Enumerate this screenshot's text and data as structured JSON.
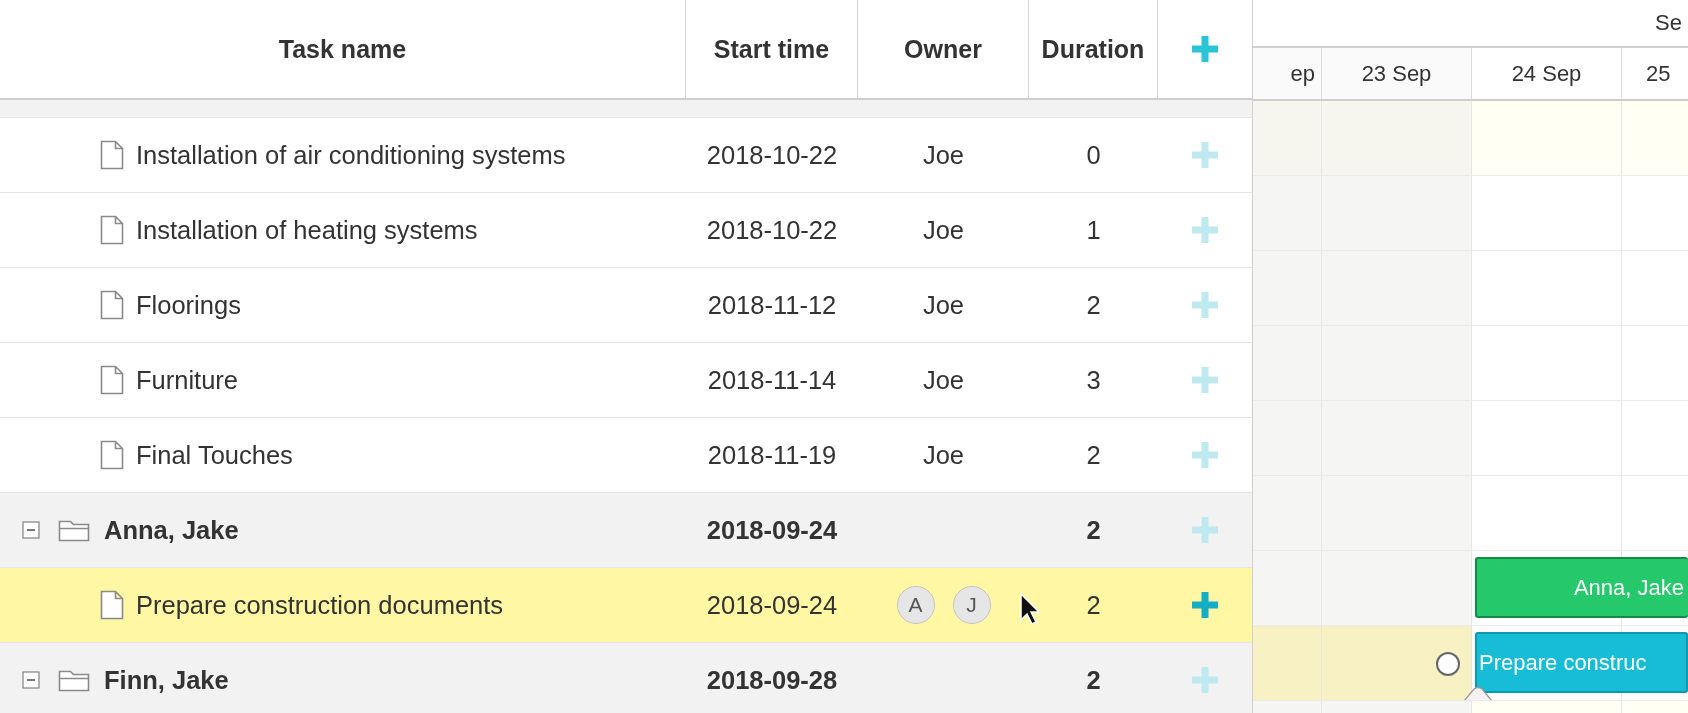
{
  "grid": {
    "columns": [
      {
        "label": "Task name"
      },
      {
        "label": "Start time"
      },
      {
        "label": "Owner"
      },
      {
        "label": "Duration"
      }
    ],
    "rows": [
      {
        "kind": "task",
        "name": "Installation of air conditioning systems",
        "start": "2018-10-22",
        "owner": "Joe",
        "duration": "0",
        "selected": false
      },
      {
        "kind": "task",
        "name": "Installation of heating systems",
        "start": "2018-10-22",
        "owner": "Joe",
        "duration": "1",
        "selected": false
      },
      {
        "kind": "task",
        "name": "Floorings",
        "start": "2018-11-12",
        "owner": "Joe",
        "duration": "2",
        "selected": false
      },
      {
        "kind": "task",
        "name": "Furniture",
        "start": "2018-11-14",
        "owner": "Joe",
        "duration": "3",
        "selected": false
      },
      {
        "kind": "task",
        "name": "Final Touches",
        "start": "2018-11-19",
        "owner": "Joe",
        "duration": "2",
        "selected": false
      },
      {
        "kind": "project",
        "name": "Anna, Jake",
        "start": "2018-09-24",
        "duration": "2",
        "selected": false,
        "expanded": true,
        "bar": {
          "label": "Anna, Jake"
        },
        "children": [
          {
            "kind": "task",
            "name": "Prepare construction documents",
            "start": "2018-09-24",
            "owner_initials": [
              "A",
              "J"
            ],
            "duration": "2",
            "selected": true,
            "bar": {
              "label": "Prepare construc"
            }
          }
        ]
      },
      {
        "kind": "project",
        "name": "Finn, Jake",
        "start": "2018-09-28",
        "duration": "2",
        "selected": false,
        "expanded": true
      }
    ]
  },
  "timeline": {
    "month": "Se",
    "days": [
      {
        "label": "ep",
        "weekend": true
      },
      {
        "label": "23 Sep",
        "weekend": true
      },
      {
        "label": "24 Sep",
        "weekend": false
      },
      {
        "label": "25",
        "weekend": false
      }
    ]
  }
}
